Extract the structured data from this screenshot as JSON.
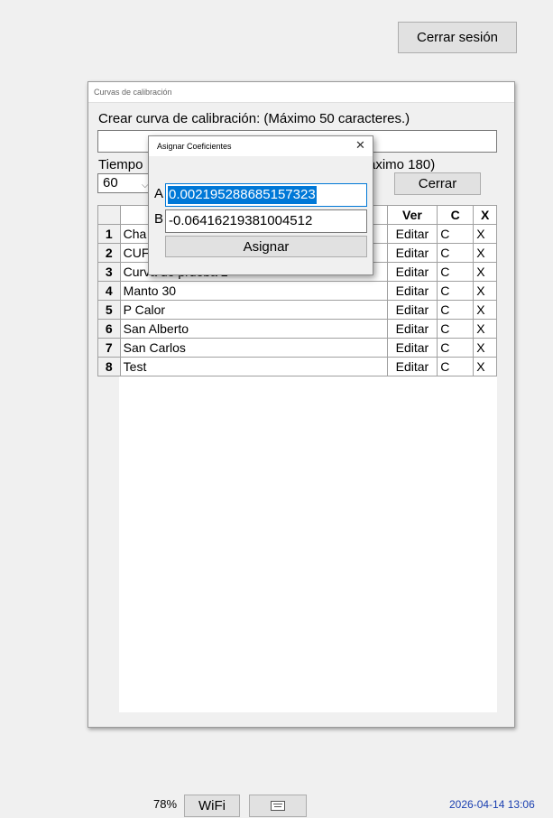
{
  "header": {
    "logout_label": "Cerrar sesión"
  },
  "main_window": {
    "title": "Curvas de calibración",
    "create_label": "Crear curva de calibración: (Máximo 50 caracteres.)",
    "name_input_value": "",
    "time_label_start": "Tiempo",
    "time_label_end": "áximo 180)",
    "time_select_value": "60",
    "close_label": "Cerrar"
  },
  "table": {
    "headers": {
      "row": "",
      "name": "",
      "ver": "Ver",
      "c": "C",
      "x": "X"
    },
    "rows": [
      {
        "n": "1",
        "name": "Cha",
        "ver": "Editar",
        "c": "C",
        "x": "X"
      },
      {
        "n": "2",
        "name": "CUF",
        "ver": "Editar",
        "c": "C",
        "x": "X"
      },
      {
        "n": "3",
        "name": "Curva de prueba 2",
        "ver": "Editar",
        "c": "C",
        "x": "X"
      },
      {
        "n": "4",
        "name": "Manto 30",
        "ver": "Editar",
        "c": "C",
        "x": "X"
      },
      {
        "n": "5",
        "name": "P Calor",
        "ver": "Editar",
        "c": "C",
        "x": "X"
      },
      {
        "n": "6",
        "name": "San Alberto",
        "ver": "Editar",
        "c": "C",
        "x": "X"
      },
      {
        "n": "7",
        "name": "San Carlos",
        "ver": "Editar",
        "c": "C",
        "x": "X"
      },
      {
        "n": "8",
        "name": "Test",
        "ver": "Editar",
        "c": "C",
        "x": "X"
      }
    ]
  },
  "dialog": {
    "title": "Asignar Coeficientes",
    "close_glyph": "✕",
    "label_a": "A",
    "value_a": "0.002195288685157323",
    "label_b": "B",
    "value_b": "-0.06416219381004512",
    "assign_label": "Asignar"
  },
  "status_bar": {
    "battery": "78%",
    "wifi_label": "WiFi",
    "clock": "2026-04-14 13:06"
  },
  "icons": {
    "keyboard": "keyboard-icon",
    "dropdown": "chevron-down-icon",
    "close": "close-icon"
  }
}
